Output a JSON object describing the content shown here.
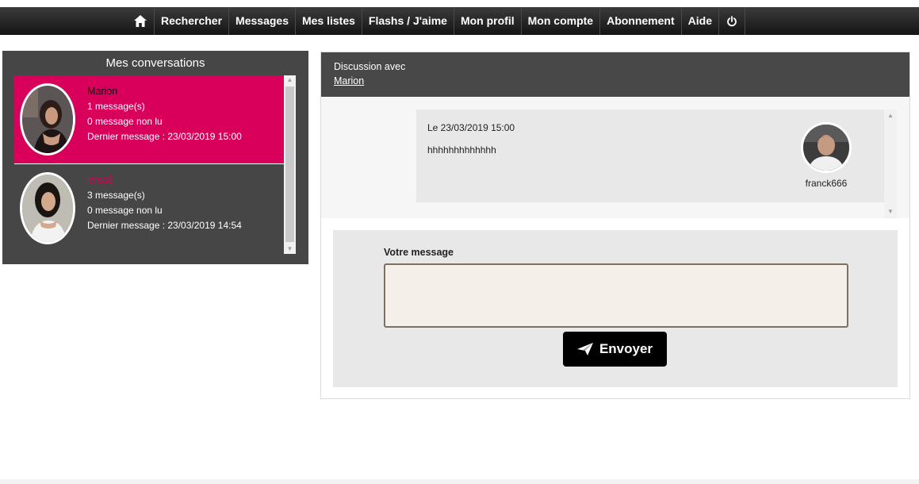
{
  "nav": {
    "items": [
      {
        "label": "Rechercher"
      },
      {
        "label": "Messages"
      },
      {
        "label": "Mes listes"
      },
      {
        "label": "Flashs / J'aime"
      },
      {
        "label": "Mon profil"
      },
      {
        "label": "Mon compte"
      },
      {
        "label": "Abonnement"
      },
      {
        "label": "Aide"
      }
    ],
    "home_icon": "home-icon",
    "logout_icon": "power-icon"
  },
  "conversations": {
    "title": "Mes conversations",
    "items": [
      {
        "name": "Marion",
        "messages": "1 message(s)",
        "unread": "0 message non lu",
        "last": "Dernier message : 23/03/2019 15:00"
      },
      {
        "name": "lmss8",
        "messages": "3 message(s)",
        "unread": "0 message non lu",
        "last": "Dernier message : 23/03/2019 14:54"
      }
    ]
  },
  "discussion": {
    "label": "Discussion avec",
    "partner": "Marion",
    "messages": [
      {
        "date": "Le 23/03/2019 15:00",
        "text": "hhhhhhhhhhhhh",
        "author": "franck666"
      }
    ]
  },
  "compose": {
    "label": "Votre message",
    "value": "",
    "send_label": "Envoyer"
  },
  "colors": {
    "accent": "#d8005b",
    "panel": "#464646",
    "button": "#000000"
  }
}
